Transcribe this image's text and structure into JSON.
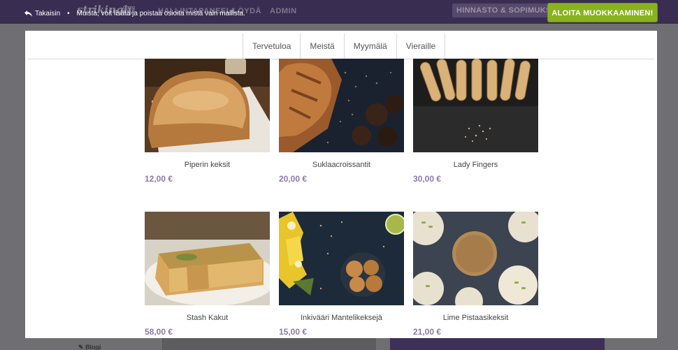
{
  "app": {
    "brand": "strikingly",
    "vip_badge": "VIP",
    "nav": [
      "HALLINTAPANEELI",
      "LÖYDÄ",
      "ADMIN"
    ],
    "pricing_button": "HINNASTO & SOPIMUKSET",
    "start_button": "ALOITA MUOKKAAMINEN!",
    "back_label": "Takaisin",
    "notice": "Muista, voit lisätä ja poistaa osioita mistä vain mallista.",
    "sidebar_blog": "Blogi"
  },
  "site": {
    "tabs": [
      "Tervetuloa",
      "Meistä",
      "Myymälä",
      "Vieraille"
    ],
    "products": [
      {
        "name": "Piperin keksit",
        "price": "12,00 €",
        "image": "bread-loaf"
      },
      {
        "name": "Suklaacroissantit",
        "price": "20,00 €",
        "image": "croissant-dark"
      },
      {
        "name": "Lady Fingers",
        "price": "30,00 €",
        "image": "ladyfinger-tray"
      },
      {
        "name": "Stash Kakut",
        "price": "58,00 €",
        "image": "quiche-pie"
      },
      {
        "name": "Inkivääri Mantelikeksejä",
        "price": "15,00 €",
        "image": "ginger-cookies-flowers"
      },
      {
        "name": "Lime Pistaasikeksit",
        "price": "21,00 €",
        "image": "pistachio-cookies"
      }
    ]
  },
  "colors": {
    "topbar": "#3a2d52",
    "accent_green": "#88b21f",
    "price_purple": "#8a7aa8"
  }
}
